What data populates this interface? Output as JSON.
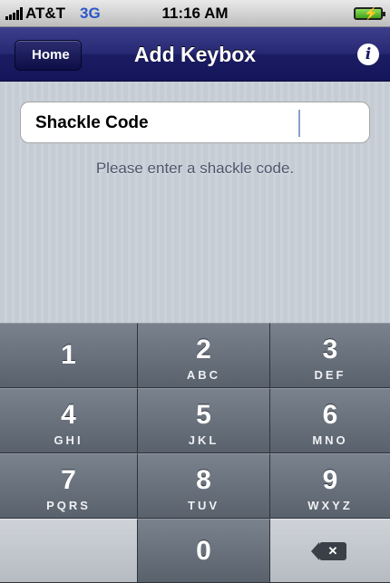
{
  "status_bar": {
    "carrier": "AT&T",
    "network": "3G",
    "time": "11:16 AM",
    "signal_icon": "signal-bars-icon",
    "battery_icon": "battery-charging-icon"
  },
  "nav": {
    "back_label": "Home",
    "title": "Add Keybox",
    "info_icon": "info-icon",
    "info_glyph": "i"
  },
  "form": {
    "field_label": "Shackle Code",
    "field_value": "",
    "hint": "Please enter a shackle code."
  },
  "keypad": {
    "keys": [
      {
        "digit": "1",
        "letters": ""
      },
      {
        "digit": "2",
        "letters": "ABC"
      },
      {
        "digit": "3",
        "letters": "DEF"
      },
      {
        "digit": "4",
        "letters": "GHI"
      },
      {
        "digit": "5",
        "letters": "JKL"
      },
      {
        "digit": "6",
        "letters": "MNO"
      },
      {
        "digit": "7",
        "letters": "PQRS"
      },
      {
        "digit": "8",
        "letters": "TUV"
      },
      {
        "digit": "9",
        "letters": "WXYZ"
      },
      {
        "digit": "0",
        "letters": ""
      }
    ],
    "delete_icon": "backspace-icon"
  },
  "colors": {
    "nav_bar": "#1b1c62",
    "network_text": "#2a57c9",
    "keypad_key": "#69717c",
    "content_background": "#c5ccd4"
  }
}
